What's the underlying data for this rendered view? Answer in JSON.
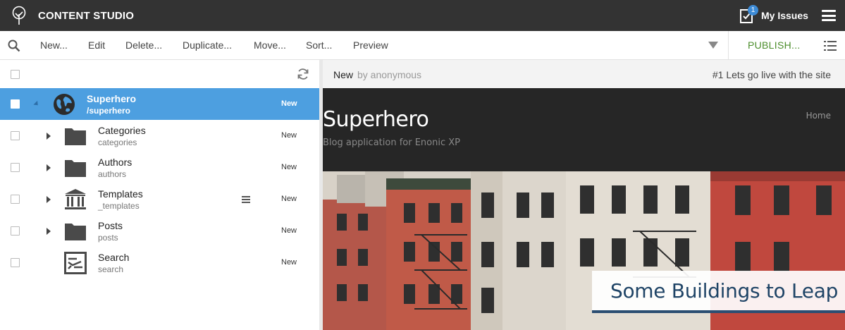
{
  "app": {
    "title": "CONTENT STUDIO",
    "logo_icon": "tree-logo-icon"
  },
  "topbar": {
    "issues_label": "My Issues",
    "issues_count": "1",
    "issues_icon": "checklist-icon",
    "menu_icon": "hamburger-icon"
  },
  "toolbar": {
    "search_icon": "search-icon",
    "actions": [
      "New...",
      "Edit",
      "Delete...",
      "Duplicate...",
      "Move...",
      "Sort...",
      "Preview"
    ],
    "publish_label": "PUBLISH...",
    "publish_color": "#4b8d2b",
    "dropdown_icon": "caret-down-icon",
    "view_toggle_icon": "list-view-icon"
  },
  "tree": {
    "refresh_icon": "refresh-icon",
    "selected_color": "#4d9fe0",
    "items": [
      {
        "name": "Superhero",
        "path": "/superhero",
        "status": "New",
        "icon": "globe-icon",
        "selected": true,
        "expanded": true
      },
      {
        "name": "Categories",
        "path": "categories",
        "status": "New",
        "icon": "folder-icon",
        "selected": false
      },
      {
        "name": "Authors",
        "path": "authors",
        "status": "New",
        "icon": "folder-icon",
        "selected": false
      },
      {
        "name": "Templates",
        "path": "_templates",
        "status": "New",
        "icon": "templates-icon",
        "selected": false
      },
      {
        "name": "Posts",
        "path": "posts",
        "status": "New",
        "icon": "folder-icon",
        "selected": false
      },
      {
        "name": "Search",
        "path": "search",
        "status": "New",
        "icon": "search-page-icon",
        "selected": false
      }
    ]
  },
  "preview": {
    "status": "New",
    "by": "by anonymous",
    "issue": "#1 Lets go live with the site",
    "site_title": "Superhero",
    "site_subtitle": "Blog application for Enonic XP",
    "nav_home": "Home",
    "hero_caption": "Some Buildings to Leap",
    "caption_color": "#1f4466"
  }
}
